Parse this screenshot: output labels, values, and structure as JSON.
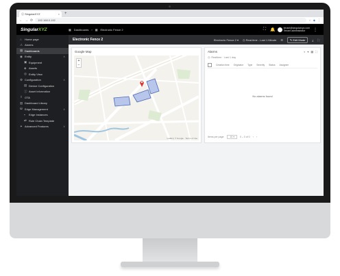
{
  "browser": {
    "tab_title": "ⓢ SingularXYZ",
    "url": "192.168.0.192"
  },
  "app": {
    "logo_main": "Singular",
    "logo_accent": "XYZ",
    "breadcrumb_1": "Dashboards",
    "breadcrumb_2": "Electronic Fence 2",
    "user_email": "tenant@singularxyz.com",
    "user_role": "Tenant administrator"
  },
  "sidebar": {
    "items": [
      {
        "label": "Home page",
        "icon": "home-icon",
        "sub": false,
        "active": false
      },
      {
        "label": "Alarms",
        "icon": "alarm-icon",
        "sub": false,
        "active": false
      },
      {
        "label": "Dashboards",
        "icon": "dashboard-icon",
        "sub": false,
        "active": true
      },
      {
        "label": "Entity",
        "icon": "entity-icon",
        "sub": false,
        "active": false,
        "chevron": "∧"
      },
      {
        "label": "Equipment",
        "icon": "equipment-icon",
        "sub": true,
        "active": false
      },
      {
        "label": "Assets",
        "icon": "asset-icon",
        "sub": true,
        "active": false
      },
      {
        "label": "Entity View",
        "icon": "view-icon",
        "sub": true,
        "active": false
      },
      {
        "label": "Configuration",
        "icon": "config-icon",
        "sub": false,
        "active": false,
        "chevron": "∧"
      },
      {
        "label": "Device Configuration",
        "icon": "device-icon",
        "sub": true,
        "active": false
      },
      {
        "label": "Asset Information",
        "icon": "info-icon",
        "sub": true,
        "active": false
      },
      {
        "label": "OTA",
        "icon": "ota-icon",
        "sub": false,
        "active": false
      },
      {
        "label": "Dashboard Library",
        "icon": "library-icon",
        "sub": false,
        "active": false
      },
      {
        "label": "Edge Management",
        "icon": "edge-icon",
        "sub": false,
        "active": false,
        "chevron": "∧"
      },
      {
        "label": "Edge Instances",
        "icon": "instance-icon",
        "sub": true,
        "active": false
      },
      {
        "label": "Rule Chain Template",
        "icon": "rule-icon",
        "sub": true,
        "active": false
      },
      {
        "label": "Advanced Features",
        "icon": "advanced-icon",
        "sub": false,
        "active": false,
        "chevron": "∨"
      }
    ]
  },
  "dashboard": {
    "title": "Electronic Fence 2",
    "state_select": "Electronic Fence 2",
    "time_window": "Real-time - Last 1 Minute",
    "edit_label": "Edit Mode"
  },
  "map_widget": {
    "title": "Google Map",
    "zoom_in": "+",
    "zoom_out": "−",
    "attribution": "Leaflet | © Google · Terms of Use"
  },
  "alarm_widget": {
    "title": "Alarms",
    "search_label": "Realtime · Last 1 day",
    "columns": [
      "Creation time",
      "Originator",
      "Type",
      "Severity",
      "Status",
      "Assignee"
    ],
    "empty_text": "No alarms found",
    "per_page_label": "Items per page:",
    "per_page_value": "10",
    "range": "0 – 0 of 0"
  },
  "colors": {
    "accent": "#7ec242",
    "sidebar_bg": "#1e1f22",
    "topbar_bg": "#000000",
    "fence_fill": "#6c86c9"
  }
}
